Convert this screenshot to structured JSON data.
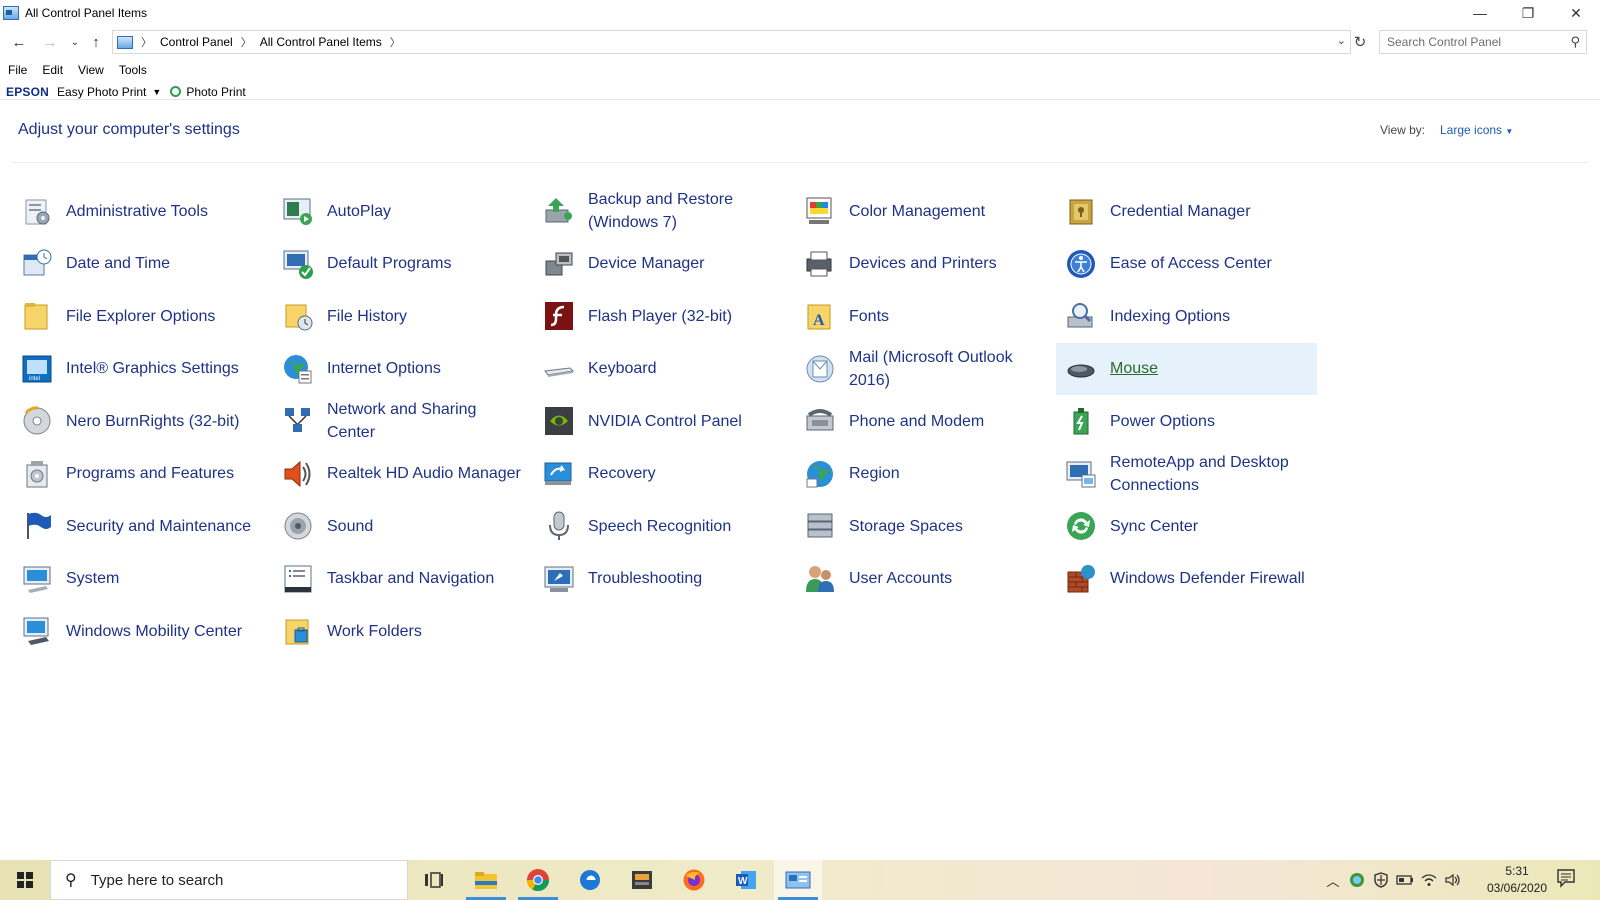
{
  "window": {
    "title": "All Control Panel Items",
    "minimize_glyph": "—",
    "restore_glyph": "❐",
    "close_glyph": "✕"
  },
  "address": {
    "crumbs": [
      "Control Panel",
      "All Control Panel Items"
    ],
    "search_placeholder": "Search Control Panel"
  },
  "menu": [
    "File",
    "Edit",
    "View",
    "Tools"
  ],
  "epson_toolbar": {
    "brand": "EPSON",
    "easy_photo_print": "Easy Photo Print",
    "photo_print": "Photo Print"
  },
  "header": {
    "title": "Adjust your computer's settings",
    "view_by_label": "View by:",
    "view_mode": "Large icons"
  },
  "items": [
    {
      "label": "Administrative Tools",
      "icon": "admin-tools-icon"
    },
    {
      "label": "AutoPlay",
      "icon": "autoplay-icon"
    },
    {
      "label": "Backup and Restore (Windows 7)",
      "icon": "backup-restore-icon"
    },
    {
      "label": "Color Management",
      "icon": "color-management-icon"
    },
    {
      "label": "Credential Manager",
      "icon": "credential-manager-icon"
    },
    {
      "label": "Date and Time",
      "icon": "date-time-icon"
    },
    {
      "label": "Default Programs",
      "icon": "default-programs-icon"
    },
    {
      "label": "Device Manager",
      "icon": "device-manager-icon"
    },
    {
      "label": "Devices and Printers",
      "icon": "devices-printers-icon"
    },
    {
      "label": "Ease of Access Center",
      "icon": "ease-of-access-icon"
    },
    {
      "label": "File Explorer Options",
      "icon": "file-explorer-options-icon"
    },
    {
      "label": "File History",
      "icon": "file-history-icon"
    },
    {
      "label": "Flash Player (32-bit)",
      "icon": "flash-player-icon"
    },
    {
      "label": "Fonts",
      "icon": "fonts-icon"
    },
    {
      "label": "Indexing Options",
      "icon": "indexing-options-icon"
    },
    {
      "label": "Intel® Graphics Settings",
      "icon": "intel-graphics-icon"
    },
    {
      "label": "Internet Options",
      "icon": "internet-options-icon"
    },
    {
      "label": "Keyboard",
      "icon": "keyboard-icon"
    },
    {
      "label": "Mail (Microsoft Outlook 2016)",
      "icon": "mail-icon"
    },
    {
      "label": "Mouse",
      "icon": "mouse-icon",
      "selected": true
    },
    {
      "label": "Nero BurnRights (32-bit)",
      "icon": "nero-burnrights-icon"
    },
    {
      "label": "Network and Sharing Center",
      "icon": "network-sharing-icon"
    },
    {
      "label": "NVIDIA Control Panel",
      "icon": "nvidia-icon"
    },
    {
      "label": "Phone and Modem",
      "icon": "phone-modem-icon"
    },
    {
      "label": "Power Options",
      "icon": "power-options-icon"
    },
    {
      "label": "Programs and Features",
      "icon": "programs-features-icon"
    },
    {
      "label": "Realtek HD Audio Manager",
      "icon": "realtek-audio-icon"
    },
    {
      "label": "Recovery",
      "icon": "recovery-icon"
    },
    {
      "label": "Region",
      "icon": "region-icon"
    },
    {
      "label": "RemoteApp and Desktop Connections",
      "icon": "remoteapp-icon"
    },
    {
      "label": "Security and Maintenance",
      "icon": "security-maintenance-icon"
    },
    {
      "label": "Sound",
      "icon": "sound-icon"
    },
    {
      "label": "Speech Recognition",
      "icon": "speech-recognition-icon"
    },
    {
      "label": "Storage Spaces",
      "icon": "storage-spaces-icon"
    },
    {
      "label": "Sync Center",
      "icon": "sync-center-icon"
    },
    {
      "label": "System",
      "icon": "system-icon"
    },
    {
      "label": "Taskbar and Navigation",
      "icon": "taskbar-navigation-icon"
    },
    {
      "label": "Troubleshooting",
      "icon": "troubleshooting-icon"
    },
    {
      "label": "User Accounts",
      "icon": "user-accounts-icon"
    },
    {
      "label": "Windows Defender Firewall",
      "icon": "firewall-icon"
    },
    {
      "label": "Windows Mobility Center",
      "icon": "mobility-center-icon"
    },
    {
      "label": "Work Folders",
      "icon": "work-folders-icon"
    }
  ],
  "taskbar": {
    "search_placeholder": "Type here to search",
    "time": "5:31",
    "date": "03/06/2020"
  },
  "colors": {
    "link": "#1e3287",
    "selected_bg": "#e5f1fb",
    "accent": "#3a8fd6"
  }
}
